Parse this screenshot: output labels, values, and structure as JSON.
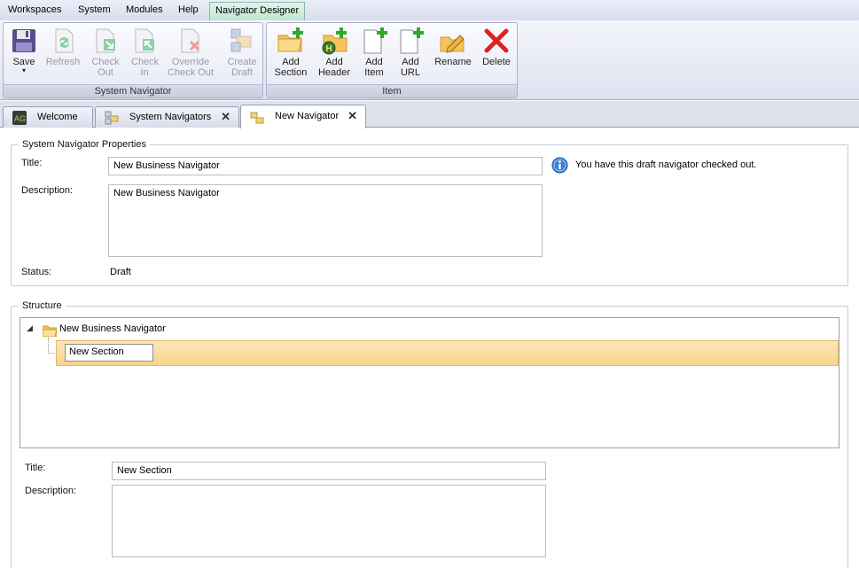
{
  "menubar": {
    "items": [
      "Workspaces",
      "System",
      "Modules",
      "Help"
    ],
    "active_tab": "Navigator Designer"
  },
  "ribbon": {
    "groups": [
      {
        "label": "System Navigator",
        "buttons": [
          {
            "label": "Save",
            "icon": "floppy-disk-icon",
            "enabled": true,
            "has_dropdown": true
          },
          {
            "label": "Refresh",
            "icon": "refresh-icon",
            "enabled": false
          },
          {
            "label": "Check Out",
            "icon": "check-out-icon",
            "enabled": false
          },
          {
            "label": "Check In",
            "icon": "check-in-icon",
            "enabled": false
          },
          {
            "label": "Override Check Out",
            "icon": "override-check-out-icon",
            "enabled": false
          },
          {
            "label": "Create Draft",
            "icon": "create-draft-icon",
            "enabled": false
          }
        ]
      },
      {
        "label": "Item",
        "buttons": [
          {
            "label": "Add Section",
            "icon": "folder-add-icon",
            "enabled": true
          },
          {
            "label": "Add Header",
            "icon": "header-add-icon",
            "enabled": true
          },
          {
            "label": "Add Item",
            "icon": "page-add-icon",
            "enabled": true
          },
          {
            "label": "Add URL",
            "icon": "url-add-icon",
            "enabled": true
          },
          {
            "label": "Rename",
            "icon": "rename-pencil-icon",
            "enabled": true
          },
          {
            "label": "Delete",
            "icon": "delete-x-icon",
            "enabled": true
          }
        ]
      }
    ]
  },
  "tabs": [
    {
      "label": "Welcome",
      "icon": "ag-logo-icon",
      "closable": false,
      "active": false
    },
    {
      "label": "System Navigators",
      "icon": "navigators-icon",
      "closable": true,
      "active": false
    },
    {
      "label": "New Navigator",
      "icon": "navigator-icon",
      "closable": true,
      "active": true
    }
  ],
  "properties": {
    "legend": "System Navigator Properties",
    "title_label": "Title:",
    "title_value": "New Business Navigator",
    "description_label": "Description:",
    "description_value": "New Business Navigator",
    "status_label": "Status:",
    "status_value": "Draft",
    "info_message": "You have this draft navigator checked out."
  },
  "structure": {
    "legend": "Structure",
    "root_label": "New Business Navigator",
    "selected_child_label": "New Section"
  },
  "section_details": {
    "title_label": "Title:",
    "title_value": "New Section",
    "description_label": "Description:",
    "description_value": ""
  },
  "colors": {
    "selection_fill": "#f8d38c",
    "active_tab_bg": "#bfe6d0",
    "delete_red": "#e02020",
    "add_green": "#2fa82f",
    "info_blue": "#3b7fd0"
  }
}
